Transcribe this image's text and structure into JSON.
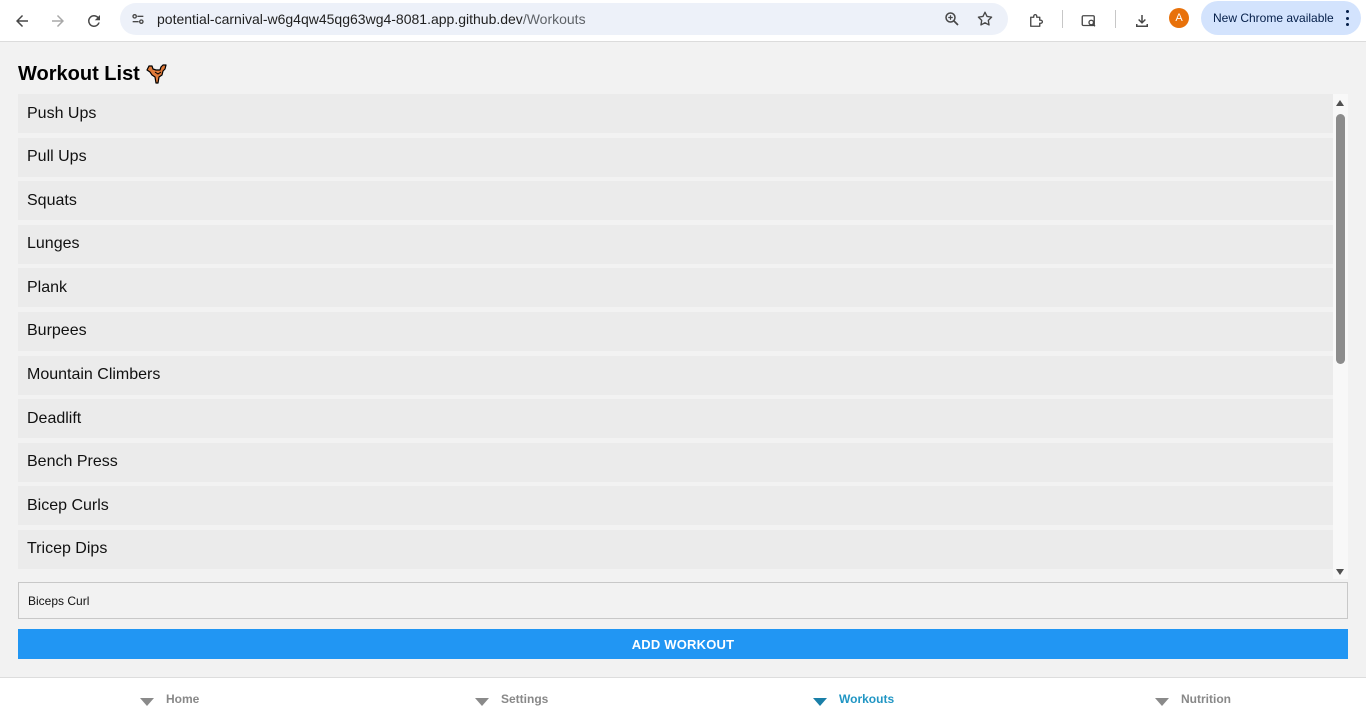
{
  "browser": {
    "url_host": "potential-carnival-w6g4qw45qg63wg4-8081.app.github.dev",
    "url_path": "/Workouts",
    "avatar_letter": "A",
    "update_label": "New Chrome available"
  },
  "page": {
    "title": "Workout List",
    "workouts": [
      "Push Ups",
      "Pull Ups",
      "Squats",
      "Lunges",
      "Plank",
      "Burpees",
      "Mountain Climbers",
      "Deadlift",
      "Bench Press",
      "Bicep Curls",
      "Tricep Dips"
    ],
    "input_value": "Biceps Curl",
    "add_button_label": "ADD WORKOUT"
  },
  "nav": {
    "tabs": [
      {
        "label": "Home",
        "active": false
      },
      {
        "label": "Settings",
        "active": false
      },
      {
        "label": "Workouts",
        "active": true
      },
      {
        "label": "Nutrition",
        "active": false
      }
    ]
  },
  "colors": {
    "accent": "#2196f3",
    "active_tab": "#2196c4",
    "avatar": "#e8710a",
    "update_pill": "#d3e3fd"
  }
}
